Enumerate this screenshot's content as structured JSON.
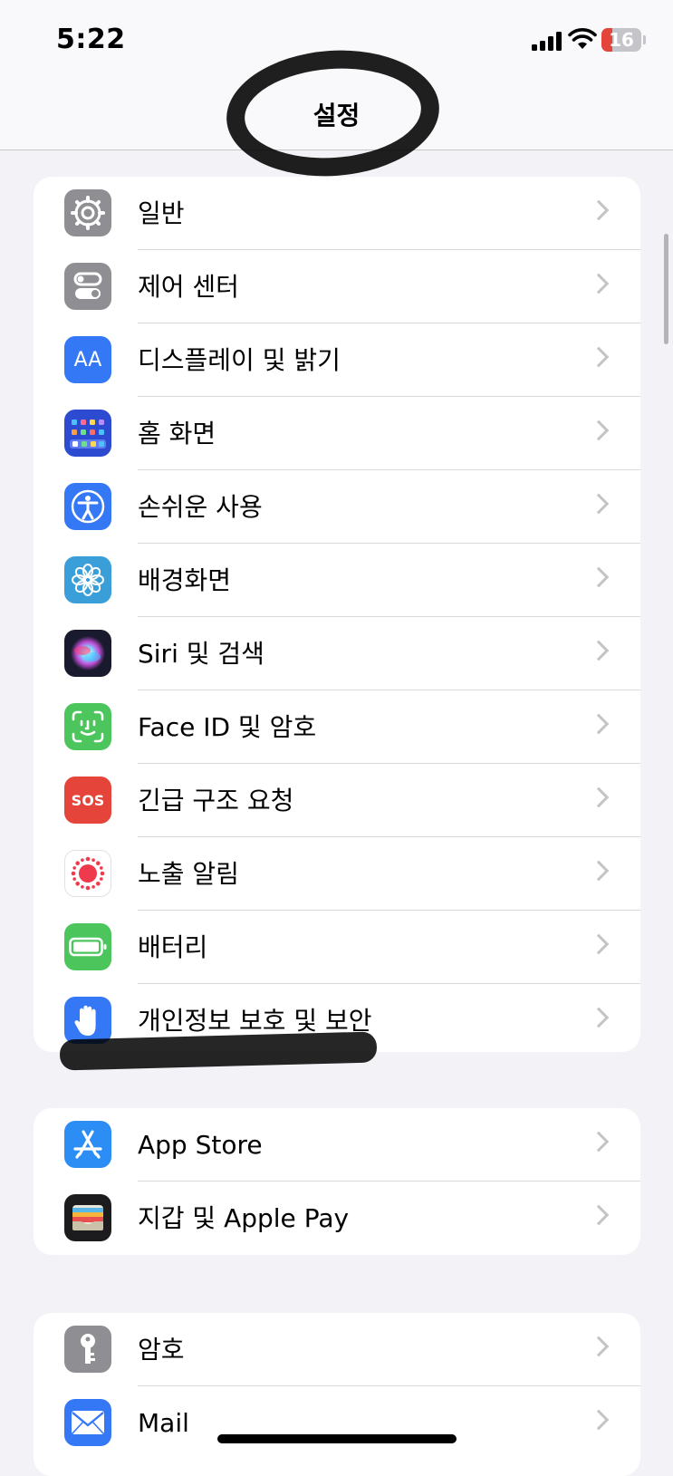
{
  "status_bar": {
    "time": "5:22",
    "battery": "16"
  },
  "nav": {
    "title": "설정"
  },
  "groups": [
    {
      "items": [
        {
          "label": "일반",
          "icon": "gear-icon",
          "color": "#8e8e93"
        },
        {
          "label": "제어 센터",
          "icon": "control-center-icon",
          "color": "#8e8e93"
        },
        {
          "label": "디스플레이 및 밝기",
          "icon": "display-icon",
          "glyph": "AA",
          "color": "#3478f6"
        },
        {
          "label": "홈 화면",
          "icon": "home-screen-icon",
          "color": "#2c4bd1"
        },
        {
          "label": "손쉬운 사용",
          "icon": "accessibility-icon",
          "color": "#3478f6"
        },
        {
          "label": "배경화면",
          "icon": "wallpaper-icon",
          "color": "#3a9fd8"
        },
        {
          "label": "Siri 및 검색",
          "icon": "siri-icon",
          "color": "#1a1a2e"
        },
        {
          "label": "Face ID 및 암호",
          "icon": "face-id-icon",
          "color": "#4cc55c"
        },
        {
          "label": "긴급 구조 요청",
          "icon": "sos-icon",
          "glyph": "SOS",
          "color": "#e5443a"
        },
        {
          "label": "노출 알림",
          "icon": "exposure-icon",
          "color": "#ffffff"
        },
        {
          "label": "배터리",
          "icon": "battery-icon",
          "color": "#4cc55c"
        },
        {
          "label": "개인정보 보호 및 보안",
          "icon": "hand-icon",
          "color": "#3478f6"
        }
      ]
    },
    {
      "items": [
        {
          "label": "App Store",
          "icon": "app-store-icon",
          "color": "#2c8ef5"
        },
        {
          "label": "지갑 및 Apple Pay",
          "icon": "wallet-icon",
          "color": "#1c1c1e"
        }
      ]
    },
    {
      "items": [
        {
          "label": "암호",
          "icon": "key-icon",
          "color": "#8e8e93"
        },
        {
          "label": "Mail",
          "icon": "mail-icon",
          "color": "#3478f6"
        }
      ]
    }
  ]
}
